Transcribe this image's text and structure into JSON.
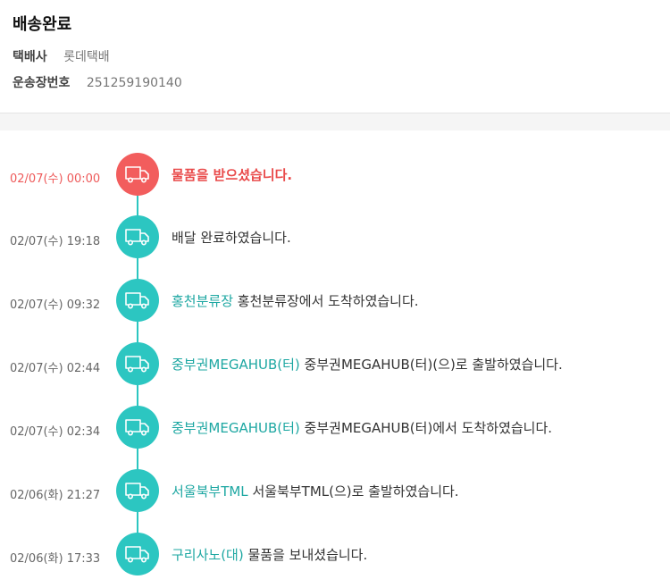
{
  "header": {
    "status_title": "배송완료",
    "carrier_label": "택배사",
    "carrier_value": "롯데택배",
    "tracking_label": "운송장번호",
    "tracking_value": "251259190140"
  },
  "colors": {
    "accent_teal": "#2cc6c1",
    "current_red": "#f25d5d",
    "location_text": "#1da7a2"
  },
  "events": [
    {
      "time": "02/07(수) 00:00",
      "location": "",
      "message": "물품을 받으셨습니다.",
      "icon": "delivery-truck-icon"
    },
    {
      "time": "02/07(수) 19:18",
      "location": "",
      "message": "배달 완료하였습니다.",
      "icon": "delivery-truck-icon"
    },
    {
      "time": "02/07(수) 09:32",
      "location": "홍천분류장",
      "message": "홍천분류장에서 도착하였습니다.",
      "icon": "delivery-truck-icon"
    },
    {
      "time": "02/07(수) 02:44",
      "location": "중부권MEGAHUB(터)",
      "message": "중부권MEGAHUB(터)(으)로 출발하였습니다.",
      "icon": "delivery-truck-icon"
    },
    {
      "time": "02/07(수) 02:34",
      "location": "중부권MEGAHUB(터)",
      "message": "중부권MEGAHUB(터)에서 도착하였습니다.",
      "icon": "delivery-truck-icon"
    },
    {
      "time": "02/06(화) 21:27",
      "location": "서울북부TML",
      "message": "서울북부TML(으)로 출발하였습니다.",
      "icon": "delivery-truck-icon"
    },
    {
      "time": "02/06(화) 17:33",
      "location": "구리사노(대)",
      "message": "물품을 보내셨습니다.",
      "icon": "delivery-truck-icon"
    }
  ]
}
